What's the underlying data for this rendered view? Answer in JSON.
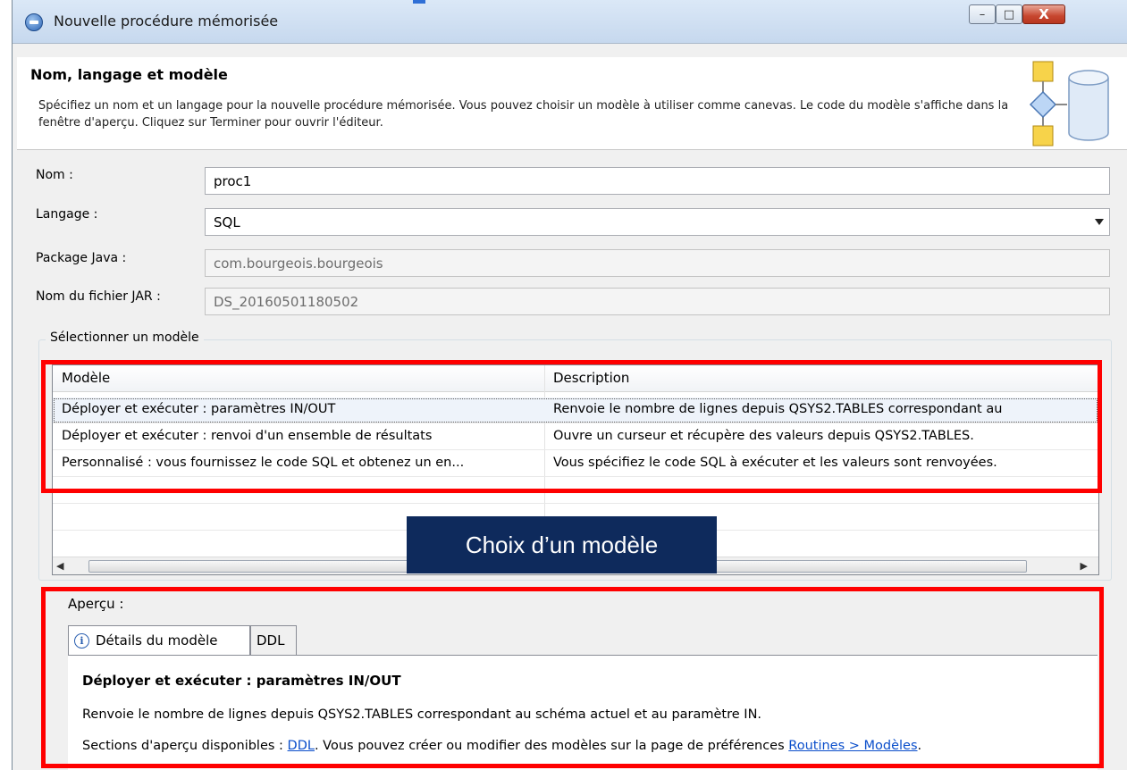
{
  "window": {
    "title": "Nouvelle procédure mémorisée",
    "controls": {
      "minimize": "–",
      "maximize": "□",
      "close": "X"
    }
  },
  "header": {
    "title": "Nom, langage et modèle",
    "description": "Spécifiez un nom et un langage pour la nouvelle procédure mémorisée. Vous pouvez choisir un modèle à utiliser comme canevas. Le code du modèle s'affiche dans la fenêtre d'aperçu. Cliquez sur Terminer pour ouvrir l'éditeur."
  },
  "form": {
    "name_label": "Nom :",
    "name_value": "proc1",
    "language_label": "Langage :",
    "language_value": "SQL",
    "java_package_label": "Package Java :",
    "java_package_value": "com.bourgeois.bourgeois",
    "jar_label": "Nom du fichier JAR :",
    "jar_value": "DS_20160501180502"
  },
  "templates": {
    "group_label": "Sélectionner un modèle",
    "columns": [
      "Modèle",
      "Description"
    ],
    "rows": [
      {
        "model": "Déployer et exécuter : paramètres IN/OUT",
        "description": "Renvoie le nombre de lignes depuis QSYS2.TABLES correspondant au",
        "selected": true
      },
      {
        "model": "Déployer et exécuter : renvoi d'un ensemble de résultats",
        "description": "Ouvre un curseur et récupère des valeurs depuis QSYS2.TABLES.",
        "selected": false
      },
      {
        "model": "Personnalisé : vous fournissez le code SQL et obtenez un en...",
        "description": "Vous spécifiez le code SQL à exécuter et les valeurs sont renvoyées.",
        "selected": false
      }
    ]
  },
  "callout": "Choix d’un modèle",
  "preview": {
    "label": "Aperçu :",
    "tabs": [
      "Détails du modèle",
      "DDL"
    ],
    "title": "Déployer et exécuter : paramètres IN/OUT",
    "description": "Renvoie le nombre de lignes depuis QSYS2.TABLES correspondant au schéma actuel et au paramètre IN.",
    "sections_prefix": "Sections d'aperçu disponibles : ",
    "sections_link": "DDL",
    "sections_middle": ". Vous pouvez créer ou modifier des modèles sur la page de préférences ",
    "prefs_link": "Routines > Modèles",
    "sections_suffix": "."
  },
  "colors": {
    "highlight_border": "#ff0000",
    "callout_bg": "#0e2a5c",
    "link": "#0a4ecb"
  }
}
